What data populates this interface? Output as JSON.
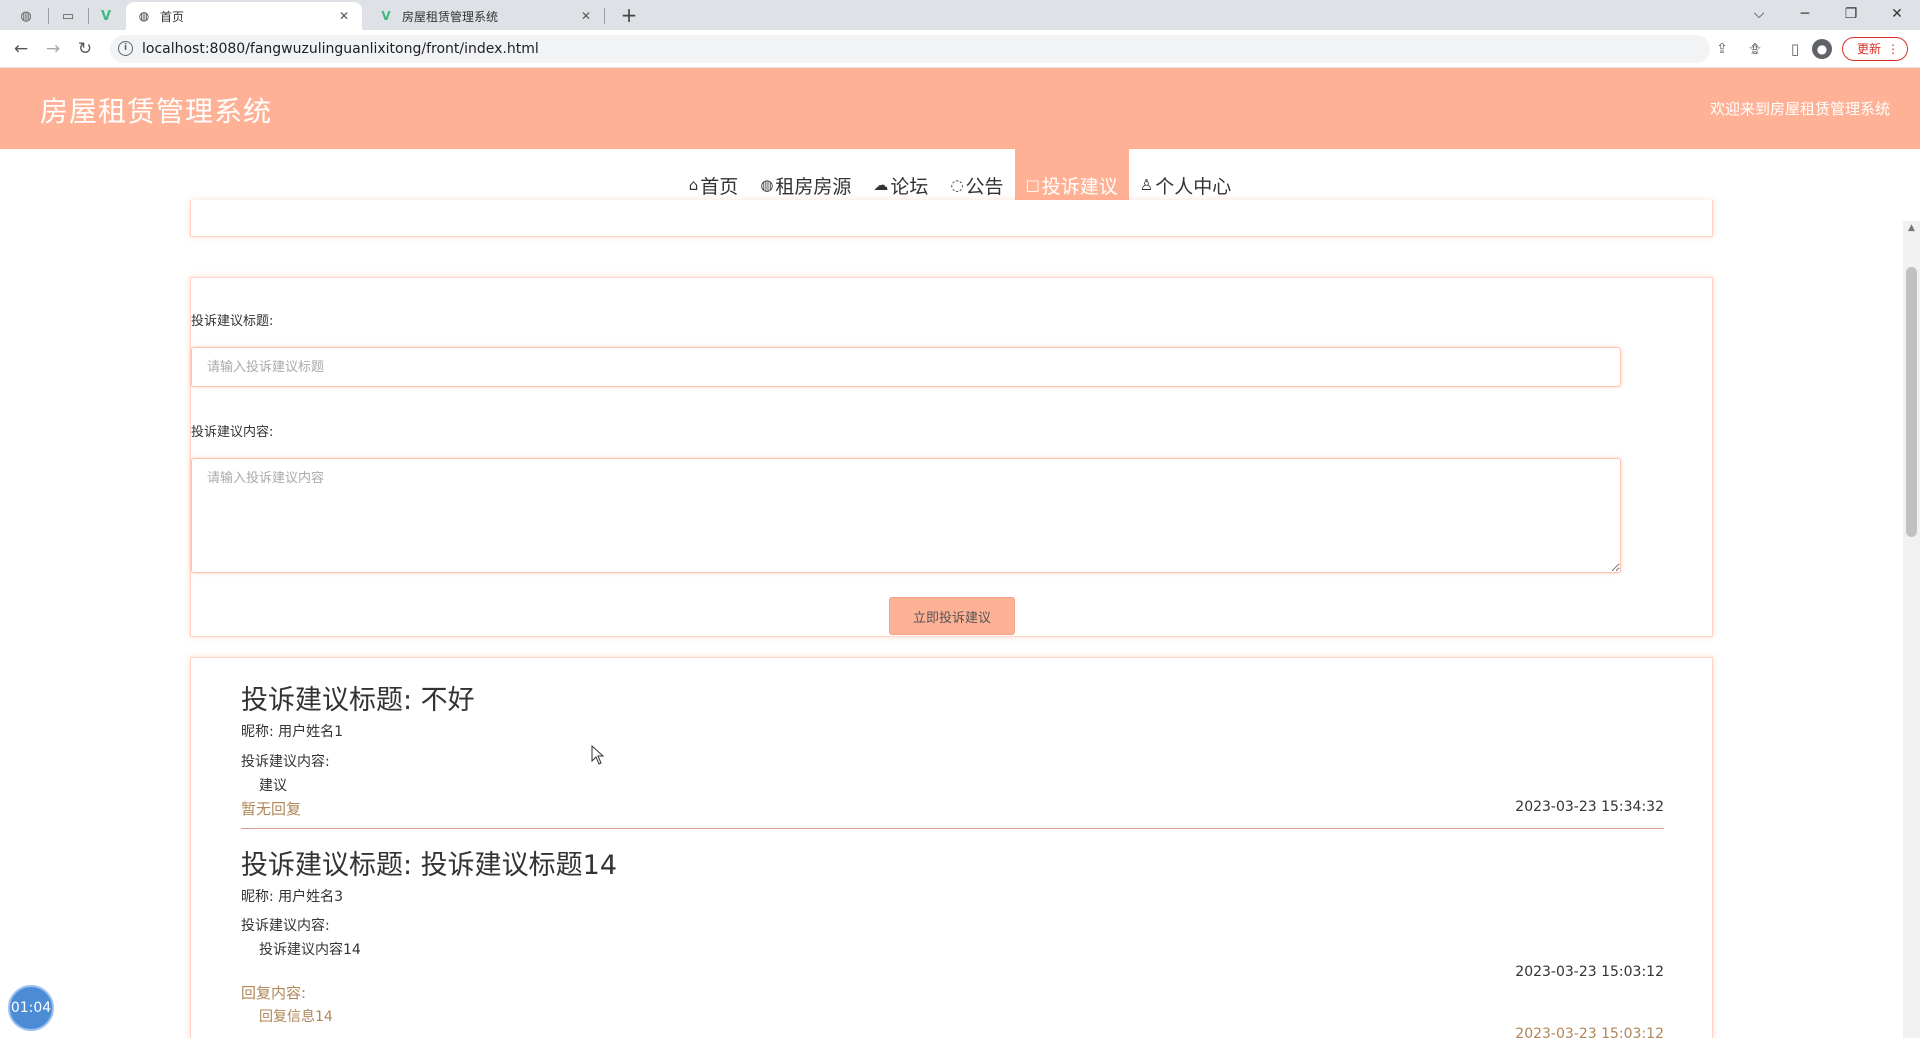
{
  "browser": {
    "tabs": [
      {
        "title": "首页",
        "active": true
      },
      {
        "title": "房屋租赁管理系统",
        "active": false
      }
    ],
    "url": "localhost:8080/fangwuzulinguanlixitong/front/index.html",
    "update_label": "更新"
  },
  "header": {
    "title": "房屋租赁管理系统",
    "welcome": "欢迎来到房屋租赁管理系统"
  },
  "nav": {
    "items": [
      {
        "label": "首页",
        "icon": "home-icon"
      },
      {
        "label": "租房房源",
        "icon": "globe-icon"
      },
      {
        "label": "论坛",
        "icon": "cloud-icon"
      },
      {
        "label": "公告",
        "icon": "palette-icon"
      },
      {
        "label": "投诉建议",
        "icon": "square-icon",
        "active": true
      },
      {
        "label": "个人中心",
        "icon": "user-icon"
      }
    ]
  },
  "form": {
    "title_label": "投诉建议标题:",
    "title_placeholder": "请输入投诉建议标题",
    "content_label": "投诉建议内容:",
    "content_placeholder": "请输入投诉建议内容",
    "submit_label": "立即投诉建议"
  },
  "entries": [
    {
      "title": "投诉建议标题: 不好",
      "nickname": "昵称: 用户姓名1",
      "content_label": "投诉建议内容:",
      "content": "建议",
      "reply_status": "暂无回复",
      "time": "2023-03-23 15:34:32"
    },
    {
      "title": "投诉建议标题: 投诉建议标题14",
      "nickname": "昵称: 用户姓名3",
      "content_label": "投诉建议内容:",
      "content": "投诉建议内容14",
      "time": "2023-03-23 15:03:12",
      "reply_label": "回复内容:",
      "reply_content": "回复信息14",
      "reply_time": "2023-03-23 15:03:12"
    }
  ],
  "timer": "01:04",
  "colors": {
    "accent": "#ffb195",
    "reply_text": "#b0865a"
  }
}
